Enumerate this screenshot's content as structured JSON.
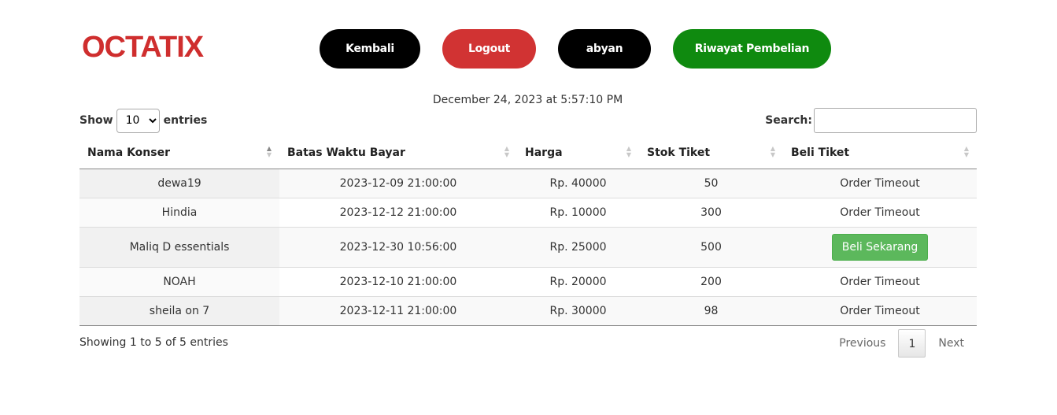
{
  "header": {
    "logo_text": "OCTATIX",
    "buttons": {
      "back": "Kembali",
      "logout": "Logout",
      "user": "abyan",
      "history": "Riwayat Pembelian"
    },
    "datetime": "December 24, 2023 at 5:57:10 PM"
  },
  "controls": {
    "show_label": "Show",
    "entries_label": "entries",
    "page_length": "10",
    "page_length_options": [
      "10"
    ],
    "search_label": "Search:",
    "search_value": ""
  },
  "table": {
    "columns": [
      "Nama Konser",
      "Batas Waktu Bayar",
      "Harga",
      "Stok Tiket",
      "Beli Tiket"
    ],
    "rows": [
      [
        "dewa19",
        "2023-12-09 21:00:00",
        "Rp. 40000",
        "50",
        "Order Timeout"
      ],
      [
        "Hindia",
        "2023-12-12 21:00:00",
        "Rp. 10000",
        "300",
        "Order Timeout"
      ],
      [
        "Maliq D essentials",
        "2023-12-30 10:56:00",
        "Rp. 25000",
        "500",
        "Beli Sekarang"
      ],
      [
        "NOAH",
        "2023-12-10 21:00:00",
        "Rp. 20000",
        "200",
        "Order Timeout"
      ],
      [
        "sheila on 7",
        "2023-12-11 21:00:00",
        "Rp. 30000",
        "98",
        "Order Timeout"
      ]
    ]
  },
  "footer": {
    "info": "Showing 1 to 5 of 5 entries",
    "previous": "Previous",
    "current_page": "1",
    "next": "Next"
  },
  "colors": {
    "brand_red": "#cf2e2e",
    "logout_red": "#d13333",
    "history_green": "#0f8a0f",
    "buy_green": "#5cb85c"
  }
}
